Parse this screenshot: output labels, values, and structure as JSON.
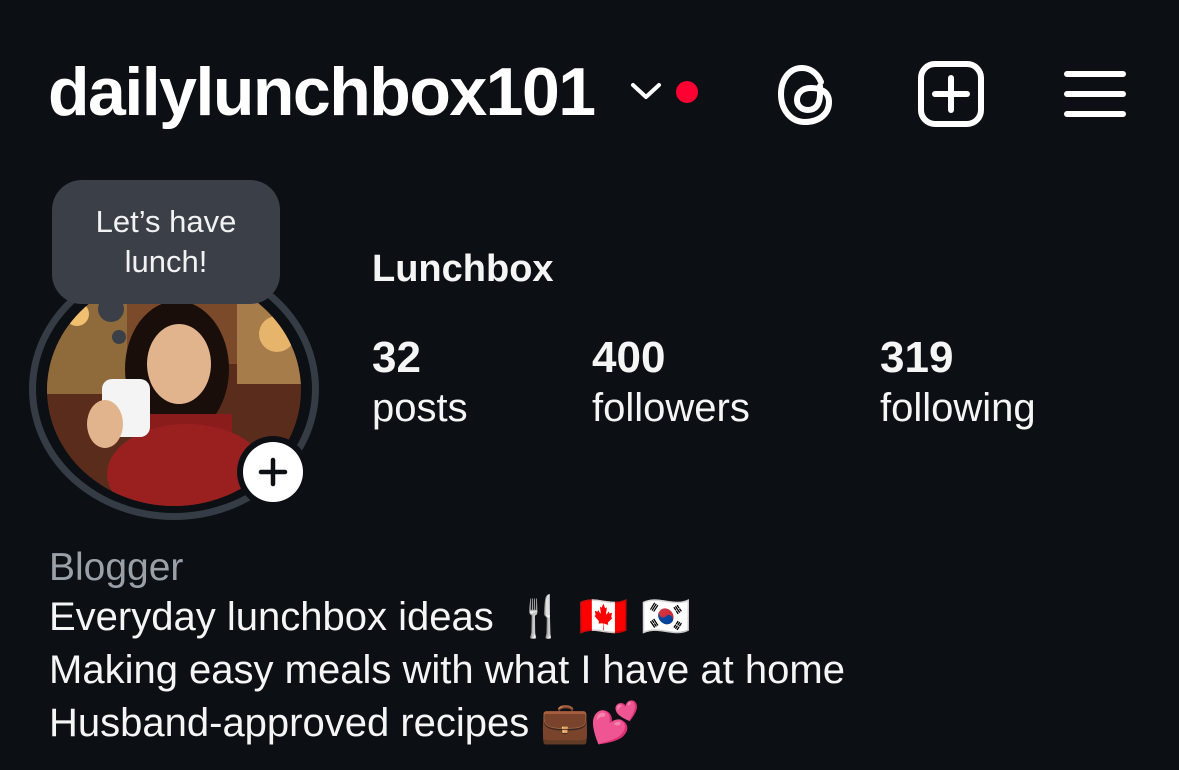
{
  "header": {
    "username": "dailylunchbox101",
    "notification_dot_color": "#ff0033",
    "icons": [
      "chevron-down-icon",
      "threads-icon",
      "new-post-icon",
      "menu-icon"
    ]
  },
  "note": {
    "text": "Let’s have lunch!"
  },
  "profile": {
    "display_name": "Lunchbox",
    "stats": {
      "posts": {
        "value": "32",
        "label": "posts"
      },
      "followers": {
        "value": "400",
        "label": "followers"
      },
      "following": {
        "value": "319",
        "label": "following"
      }
    }
  },
  "bio": {
    "category": "Blogger",
    "line1": "Everyday lunchbox ideas",
    "line1_emojis": "🍴 🇨🇦 🇰🇷",
    "line2": "Making easy meals with what I have at home",
    "line3": "Husband-approved recipes",
    "line3_emojis": "💼💕"
  }
}
